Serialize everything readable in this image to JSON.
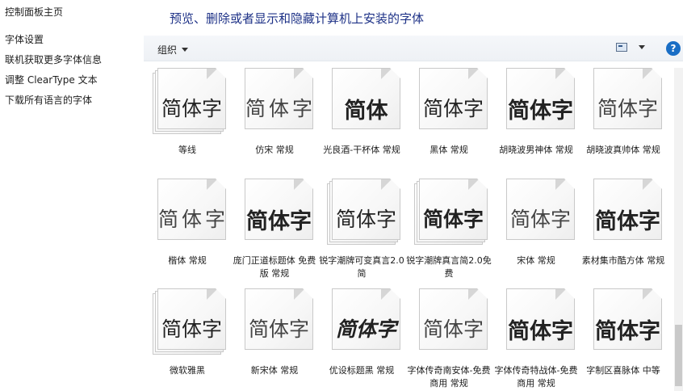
{
  "left_nav": {
    "home": "控制面板主页",
    "links": [
      "字体设置",
      "联机获取更多字体信息",
      "调整 ClearType 文本",
      "下载所有语言的字体"
    ]
  },
  "header": {
    "title": "预览、删除或者显示和隐藏计算机上安装的字体"
  },
  "toolbar": {
    "organize": "组织",
    "help": "?"
  },
  "fonts": [
    {
      "sample": "简体字",
      "label": "等线",
      "stack": 3,
      "style": "normal"
    },
    {
      "sample": "简体字",
      "label": "仿宋 常规",
      "stack": 1,
      "style": "light spaced"
    },
    {
      "sample": "简体",
      "label": "光良酒-干杯体 常规",
      "stack": 1,
      "style": "heavy"
    },
    {
      "sample": "简体字",
      "label": "黑体 常规",
      "stack": 1,
      "style": "normal"
    },
    {
      "sample": "简体字",
      "label": "胡晓波男神体 常规",
      "stack": 1,
      "style": "heavy"
    },
    {
      "sample": "简体字",
      "label": "胡晓波真帅体 常规",
      "stack": 1,
      "style": "light"
    },
    {
      "sample": "简体字",
      "label": "楷体 常规",
      "stack": 1,
      "style": "light spaced"
    },
    {
      "sample": "简体字",
      "label": "庞门正道标题体 免费版 常规",
      "stack": 1,
      "style": "heavy"
    },
    {
      "sample": "简体字",
      "label": "锐字潮牌可变真言2.0简",
      "stack": 3,
      "style": "normal"
    },
    {
      "sample": "简体字",
      "label": "锐字潮牌真言简2.0免费",
      "stack": 3,
      "style": "bold"
    },
    {
      "sample": "简体字",
      "label": "宋体 常规",
      "stack": 1,
      "style": "light"
    },
    {
      "sample": "简体字",
      "label": "素材集市酷方体 常规",
      "stack": 1,
      "style": "heavy"
    },
    {
      "sample": "简体字",
      "label": "微软雅黑",
      "stack": 3,
      "style": "normal"
    },
    {
      "sample": "简体字",
      "label": "新宋体 常规",
      "stack": 1,
      "style": "light"
    },
    {
      "sample": "简体字",
      "label": "优设标题黑 常规",
      "stack": 1,
      "style": "italic"
    },
    {
      "sample": "简体字",
      "label": "字体传奇南安体-免费商用 常规",
      "stack": 1,
      "style": "light"
    },
    {
      "sample": "简体字",
      "label": "字体传奇特战体-免费商用 常规",
      "stack": 1,
      "style": "heavy"
    },
    {
      "sample": "简体字",
      "label": "字制区喜脉体 中等",
      "stack": 1,
      "style": "heavy"
    }
  ]
}
